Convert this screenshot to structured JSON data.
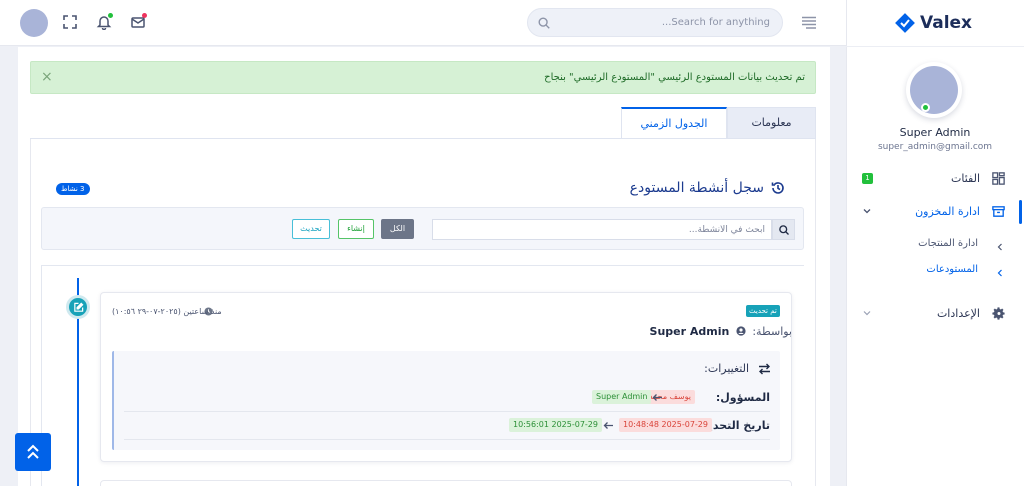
{
  "header": {
    "search_placeholder": "Search for anything..."
  },
  "sidebar": {
    "brand": "Valex",
    "user_name": "Super Admin",
    "user_email": "super_admin@gmail.com",
    "items": [
      {
        "label": "الفئات",
        "badge": "1",
        "icon": "grid-icon"
      },
      {
        "label": "ادارة المخزون",
        "icon": "archive-icon",
        "expanded": true
      },
      {
        "label": "الإعدادات",
        "icon": "gear-icon"
      }
    ],
    "subitems": [
      {
        "label": "ادارة المنتجات"
      },
      {
        "label": "المستودعات",
        "active": true
      }
    ]
  },
  "alert": {
    "text": "تم تحديث بيانات المستودع الرئيسي \"المستودع الرئيسي\" بنجاح",
    "close": "×"
  },
  "tabs": [
    {
      "label": "معلومات",
      "active": false
    },
    {
      "label": "الجدول الزمني",
      "active": true
    }
  ],
  "activity": {
    "title": "سجل أنشطة المستودع",
    "count_badge": "3 نشاط",
    "search_placeholder": "ابحث في الأنشطة...",
    "filters": {
      "all": "الكل",
      "create": "إنشاء",
      "update": "تحديث"
    }
  },
  "entry": {
    "type_badge": "تم تحديث",
    "time": "منذ ساعتين (٢٠٢٥-٠٧-٢٩ ١٠:٥٦)",
    "by_label": "بواسطة:",
    "by_name": "Super Admin",
    "changes_title": "التغييرات:",
    "changes": [
      {
        "field": "المسؤول:",
        "old": "يوسف محمد",
        "new": "Super Admin"
      },
      {
        "field": "تاريخ التحديث:",
        "old": "2025-07-29 10:48:48",
        "new": "2025-07-29 10:56:01"
      }
    ]
  },
  "colors": {
    "primary": "#0162e8",
    "success": "#22c03c",
    "info": "#17a2b8",
    "danger": "#d9443a"
  }
}
